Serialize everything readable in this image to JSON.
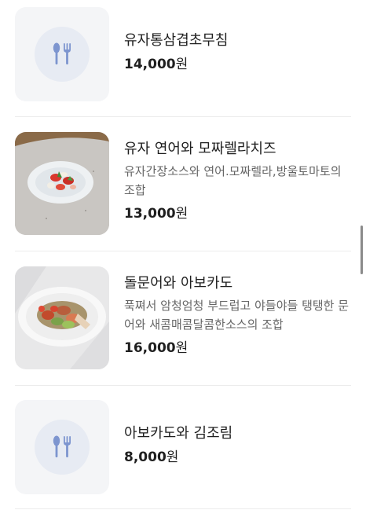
{
  "menu": {
    "currency": "원",
    "items": [
      {
        "name": "유자통삼겹초무침",
        "description": "",
        "price": "14,000",
        "image": "utensils-icon"
      },
      {
        "name": "유자 연어와 모짜렐라치즈",
        "description": "유자간장소스와 연어.모짜렐라,방울토마토의 조합",
        "price": "13,000",
        "image": "salmon-mozzarella-photo"
      },
      {
        "name": "돌문어와 아보카도",
        "description": "푹쪄서 암청엄청 부드럽고 야들야들 탱탱한 문어와 새콤매콤달콤한소스의 조합",
        "price": "16,000",
        "image": "octopus-avocado-photo"
      },
      {
        "name": "아보카도와 김조림",
        "description": "",
        "price": "8,000",
        "image": "utensils-icon"
      }
    ]
  },
  "colors": {
    "placeholder_bg": "#f4f5f7",
    "icon_color": "#7d95cf",
    "divider": "#ececec"
  }
}
